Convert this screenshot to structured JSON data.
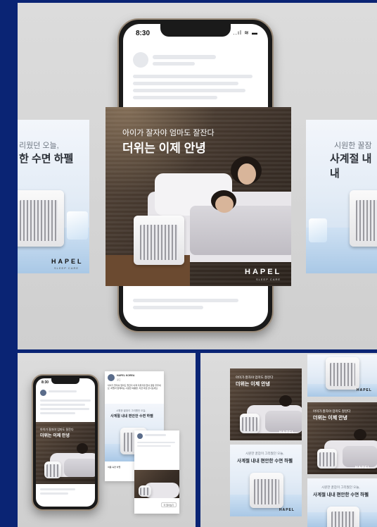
{
  "top": {
    "phone_time": "8:30",
    "status_icons": "..ıl ≋ ▬",
    "main_ad": {
      "headline_small": "아이가 잘자야 엄마도 잘잔다",
      "headline_big": "더위는 이제 안녕",
      "brand": "HAPEL",
      "brand_sub": "SLEEP CARE"
    },
    "left_ad": {
      "line1": "리웠던 오늘,",
      "line2": "한 수면 하펠",
      "brand": "HAPEL",
      "brand_sub": "SLEEP CARE"
    },
    "right_ad": {
      "line1": "시원한 꿀잠",
      "line2": "사계절 내내"
    }
  },
  "bottom_left": {
    "phone_time": "8:30",
    "post_name": "HAPEL KOREA",
    "post_sub": "광고",
    "post_text": "아이가 잘자야 엄마도 잘잔다 이제 더위걱정 없이 꿀잠 주무세요. 하펠과 함께하는 시원한 여름밤, 지금 바로 만나보세요.",
    "mini_ad_small": "아이가 잘자야 엄마도 잘잔다",
    "mini_ad_big": "더위는 이제 안녕",
    "card2_small": "시원한 꿀잠이 그리웠던 오늘,",
    "card2_big": "사계절 내내 편안한 수면 하펠",
    "brand": "HAPEL",
    "cta": "더 알아보기",
    "footer_line": "여름 숙면 하펠"
  },
  "bottom_right": {
    "dark_small": "아이가 잘자야 엄마도 잘잔다",
    "dark_big": "더위는 이제 안녕",
    "light_small": "시원한 꿀잠이 그리웠던 오늘,",
    "light_big": "사계절 내내 편안한 수면 하펠",
    "brand": "HAPEL"
  }
}
